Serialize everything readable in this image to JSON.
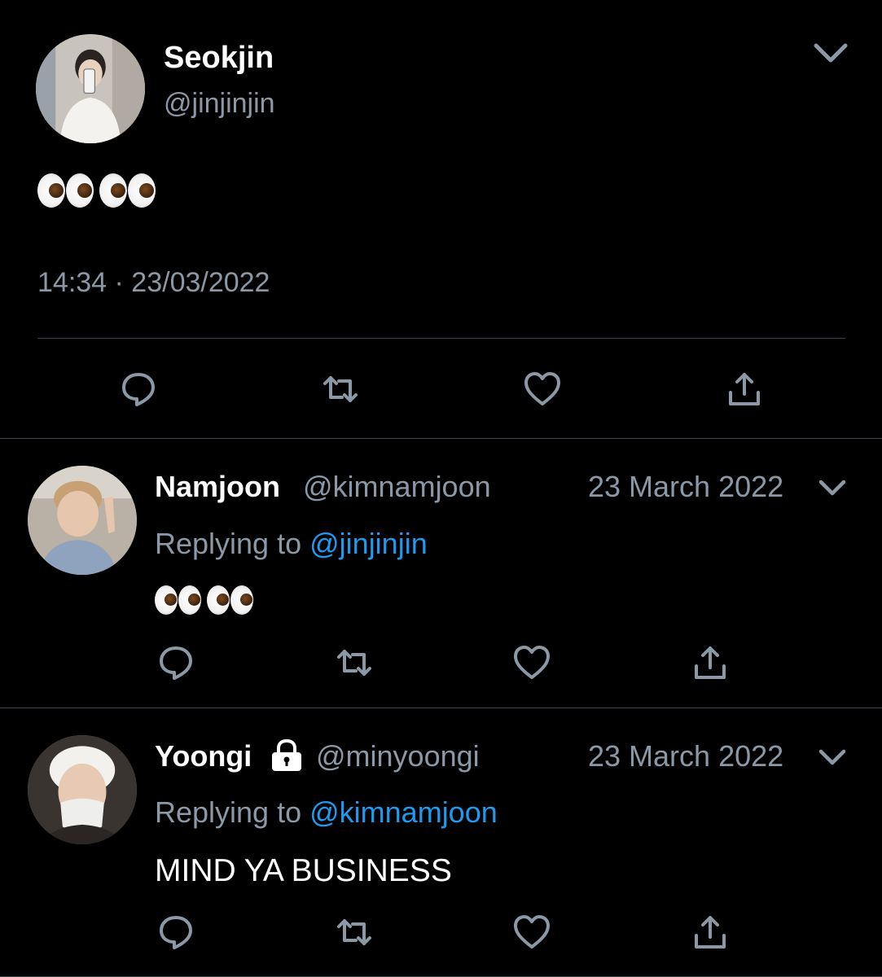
{
  "main_tweet": {
    "name": "Seokjin",
    "handle": "@jinjinjin",
    "emoji_text": "👀👀",
    "timestamp": "14:34 · 23/03/2022"
  },
  "replies": [
    {
      "name": "Namjoon",
      "handle": "@kimnamjoon",
      "date": "23 March 2022",
      "replying_label": "Replying to",
      "replying_to": "@jinjinjin",
      "text": "👀👀"
    },
    {
      "name": "Yoongi",
      "protected_icon": "lock-icon",
      "handle": "@minyoongi",
      "date": "23 March 2022",
      "replying_label": "Replying to",
      "replying_to": "@kimnamjoon",
      "text": "MIND YA BUSINESS"
    }
  ],
  "actions": [
    "reply-icon",
    "retweet-icon",
    "like-icon",
    "share-icon"
  ],
  "colors": {
    "background": "#000000",
    "text": "#ffffff",
    "muted": "#8b98a5",
    "link": "#1d9bf0",
    "divider": "#38444d"
  }
}
